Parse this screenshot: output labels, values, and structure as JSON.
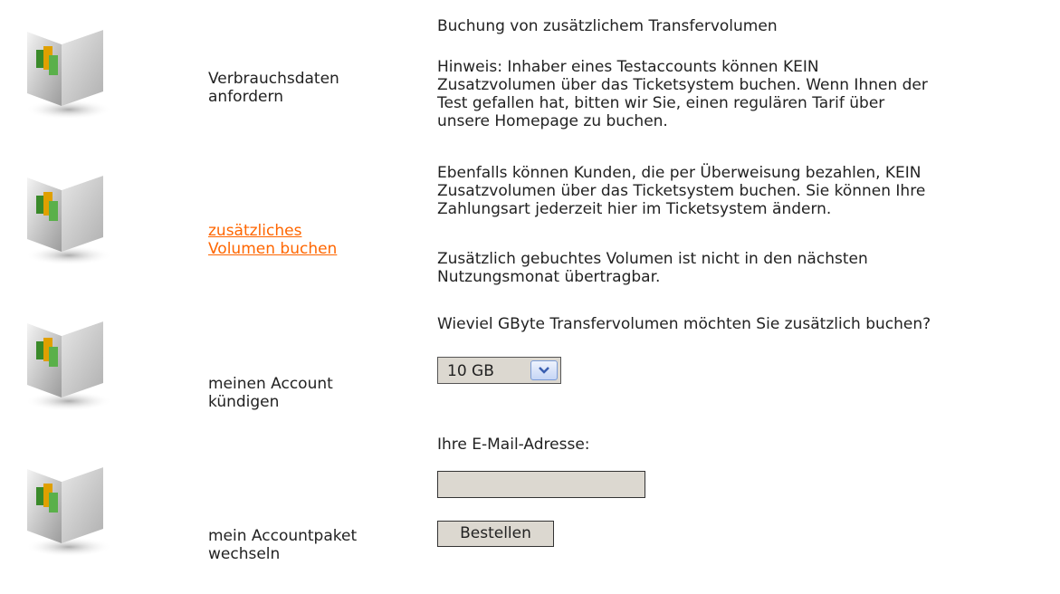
{
  "sidebar": {
    "items": [
      {
        "icon": "book-cube-icon",
        "label": "Verbrauchsdaten\nanfordern",
        "is_link": false
      },
      {
        "icon": "book-cube-icon",
        "label": "zusätzliches\nVolumen buchen",
        "is_link": true
      },
      {
        "icon": "book-cube-icon",
        "label": "meinen Account\nkündigen",
        "is_link": false
      },
      {
        "icon": "book-cube-icon",
        "label": "mein Accountpaket\nwechseln",
        "is_link": false
      }
    ]
  },
  "main": {
    "title": "Buchung von zusätzlichem Transfervolumen",
    "note_paragraph": "Hinweis: Inhaber eines Testaccounts können KEIN\nZusatzvolumen über das Ticketsystem buchen. Wenn Ihnen der\nTest gefallen hat, bitten wir Sie, einen regulären Tarif über\nunsere Homepage zu buchen.",
    "transfer_paragraph": "Ebenfalls können Kunden, die per Überweisung bezahlen, KEIN\nZusatzvolumen über das Ticketsystem buchen. Sie können Ihre\nZahlungsart jederzeit hier im Ticketsystem ändern.",
    "carryover_paragraph": "Zusätzlich gebuchtes Volumen ist nicht in den nächsten\nNutzungsmonat übertragbar.",
    "volume_question": "Wieviel GByte Transfervolumen möchten Sie zusätzlich buchen?",
    "volume_select": {
      "selected": "10 GB"
    },
    "email_label": "Ihre E-Mail-Adresse:",
    "email_input": {
      "value": ""
    },
    "submit_label": "Bestellen"
  },
  "colors": {
    "link": "#ff6600",
    "text": "#222222",
    "control_bg": "#dcd8d0",
    "select_arrow": "#7a9bd6"
  }
}
